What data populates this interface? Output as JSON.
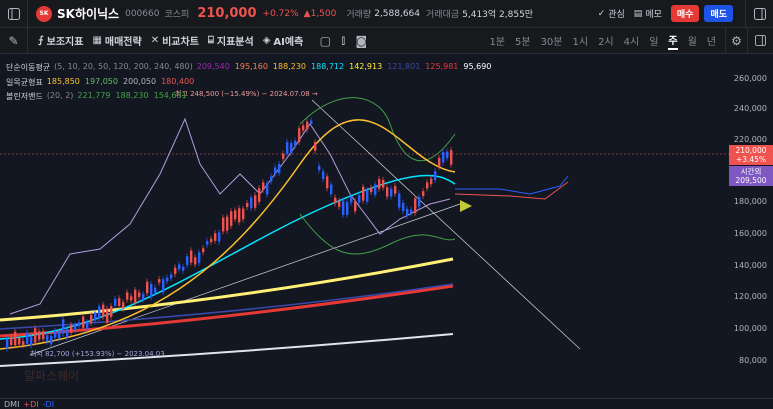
{
  "header": {
    "name": "SK하이닉스",
    "code": "000660",
    "market": "코스피",
    "price": "210,000",
    "change_pct": "+0.72%",
    "change_abs": "▲1,500",
    "volume_label": "거래량",
    "volume": "2,588,664",
    "amount_label": "거래대금",
    "amount": "5,413억 2,855만",
    "watch_label": "관심",
    "memo_label": "메모",
    "buy_label": "매수",
    "sell_label": "매도"
  },
  "toolbar": {
    "indicator": "보조지표",
    "trade": "매매전략",
    "compare": "비교차트",
    "analysis": "지표분석",
    "ai": "AI예측",
    "timeframes": [
      "1분",
      "5분",
      "30분",
      "1시",
      "2시",
      "4시",
      "일",
      "주",
      "월",
      "년"
    ],
    "active": "주"
  },
  "legend": {
    "ma": {
      "label": "단순이동평균",
      "params": "(5, 10, 20, 50, 120, 200, 240, 480)",
      "values": [
        {
          "v": "209,540",
          "c": "#9c27b0"
        },
        {
          "v": "195,160",
          "c": "#ff7f50"
        },
        {
          "v": "188,230",
          "c": "#fbc02d"
        },
        {
          "v": "188,712",
          "c": "#00e5ff"
        },
        {
          "v": "142,913",
          "c": "#ffeb3b"
        },
        {
          "v": "121,801",
          "c": "#3949ab"
        },
        {
          "v": "125,981",
          "c": "#e53935"
        },
        {
          "v": "95,690",
          "c": "#ffffff"
        }
      ]
    },
    "ichimoku": {
      "label": "일목균형표",
      "values": [
        {
          "v": "185,850",
          "c": "#fbc02d"
        },
        {
          "v": "197,050",
          "c": "#66bb6a"
        },
        {
          "v": "200,050",
          "c": "#b2b5be"
        },
        {
          "v": "180,400",
          "c": "#ef5350"
        }
      ]
    },
    "bollinger": {
      "label": "볼린저밴드",
      "params": "(20, 2)",
      "values": [
        {
          "v": "221,779",
          "c": "#43a047"
        },
        {
          "v": "188,230",
          "c": "#43a047"
        },
        {
          "v": "154,681",
          "c": "#43a047"
        }
      ]
    }
  },
  "annotations": {
    "high": "최고 248,500 (−15.49%) − 2024.07.08 →",
    "low": "최저 82,700 (+153.93%) − 2023.04.03",
    "watermark": "알파스퀘어"
  },
  "axis": {
    "ticks": [
      "260,000",
      "240,000",
      "220,000",
      "200,000",
      "180,000",
      "160,000",
      "140,000",
      "120,000",
      "100,000",
      "80,000"
    ],
    "price_tag": "210,000",
    "price_tag_pct": "+3.45%",
    "after_label": "시간외",
    "after_price": "209,500"
  },
  "bottom": {
    "label": "DMI",
    "plus": "+DI",
    "minus": "-DI"
  },
  "colors": {
    "up": "#ef5350",
    "down": "#2962ff",
    "accent": "#e53935"
  },
  "chart_data": {
    "type": "line",
    "title": "",
    "xlabel": "",
    "ylabel": "",
    "ylim": [
      80000,
      260000
    ],
    "note_current": 210000
  }
}
